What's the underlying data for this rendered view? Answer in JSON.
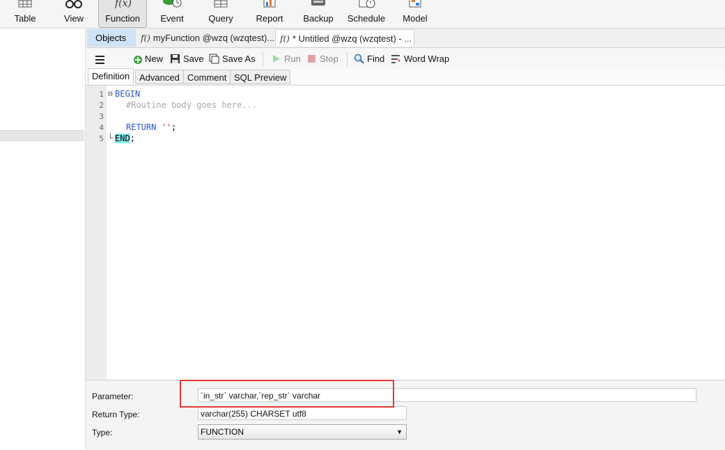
{
  "ribbon": {
    "items": [
      {
        "label": "Table",
        "icon": "table-icon"
      },
      {
        "label": "View",
        "icon": "glasses-icon"
      },
      {
        "label": "Function",
        "icon": "function-icon",
        "active": true
      },
      {
        "label": "Event",
        "icon": "event-icon"
      },
      {
        "label": "Query",
        "icon": "query-icon"
      },
      {
        "label": "Report",
        "icon": "report-icon"
      },
      {
        "label": "Backup",
        "icon": "backup-icon"
      },
      {
        "label": "Schedule",
        "icon": "schedule-icon"
      },
      {
        "label": "Model",
        "icon": "model-icon"
      }
    ]
  },
  "tabs": {
    "objects": "Objects",
    "fx_glyph": "f()",
    "tab1": "myFunction @wzq (wzqtest)...",
    "tab2": "* Untitled @wzq (wzqtest) - ..."
  },
  "toolbar": {
    "menu_icon": "hamburger-icon",
    "new": "New",
    "save": "Save",
    "save_as": "Save As",
    "run": "Run",
    "stop": "Stop",
    "find": "Find",
    "word_wrap": "Word Wrap"
  },
  "subtabs": {
    "definition": "Definition",
    "advanced": "Advanced",
    "comment": "Comment",
    "sql_preview": "SQL Preview"
  },
  "editor": {
    "line_numbers": [
      "1",
      "2",
      "3",
      "4",
      "5"
    ],
    "fold_open": "⊟",
    "fold_end": "└",
    "line1": "BEGIN",
    "line2": "#Routine body goes here...",
    "line4_kw": "RETURN",
    "line4_str": "''",
    "line4_end": ";",
    "line5_kw": "END",
    "line5_end": ";"
  },
  "form": {
    "parameter_label": "Parameter:",
    "parameter_value": "`in_str` varchar,`rep_str` varchar",
    "return_type_label": "Return Type:",
    "return_type_value": "varchar(255) CHARSET utf8",
    "type_label": "Type:",
    "type_value": "FUNCTION"
  },
  "colors": {
    "highlight_box": "#e53935",
    "keyword": "#2a57c9",
    "comment": "#a9a9a9",
    "string": "#c0392b",
    "match_highlight": "#7ff0f0",
    "objects_tab": "#cfe3f7"
  }
}
